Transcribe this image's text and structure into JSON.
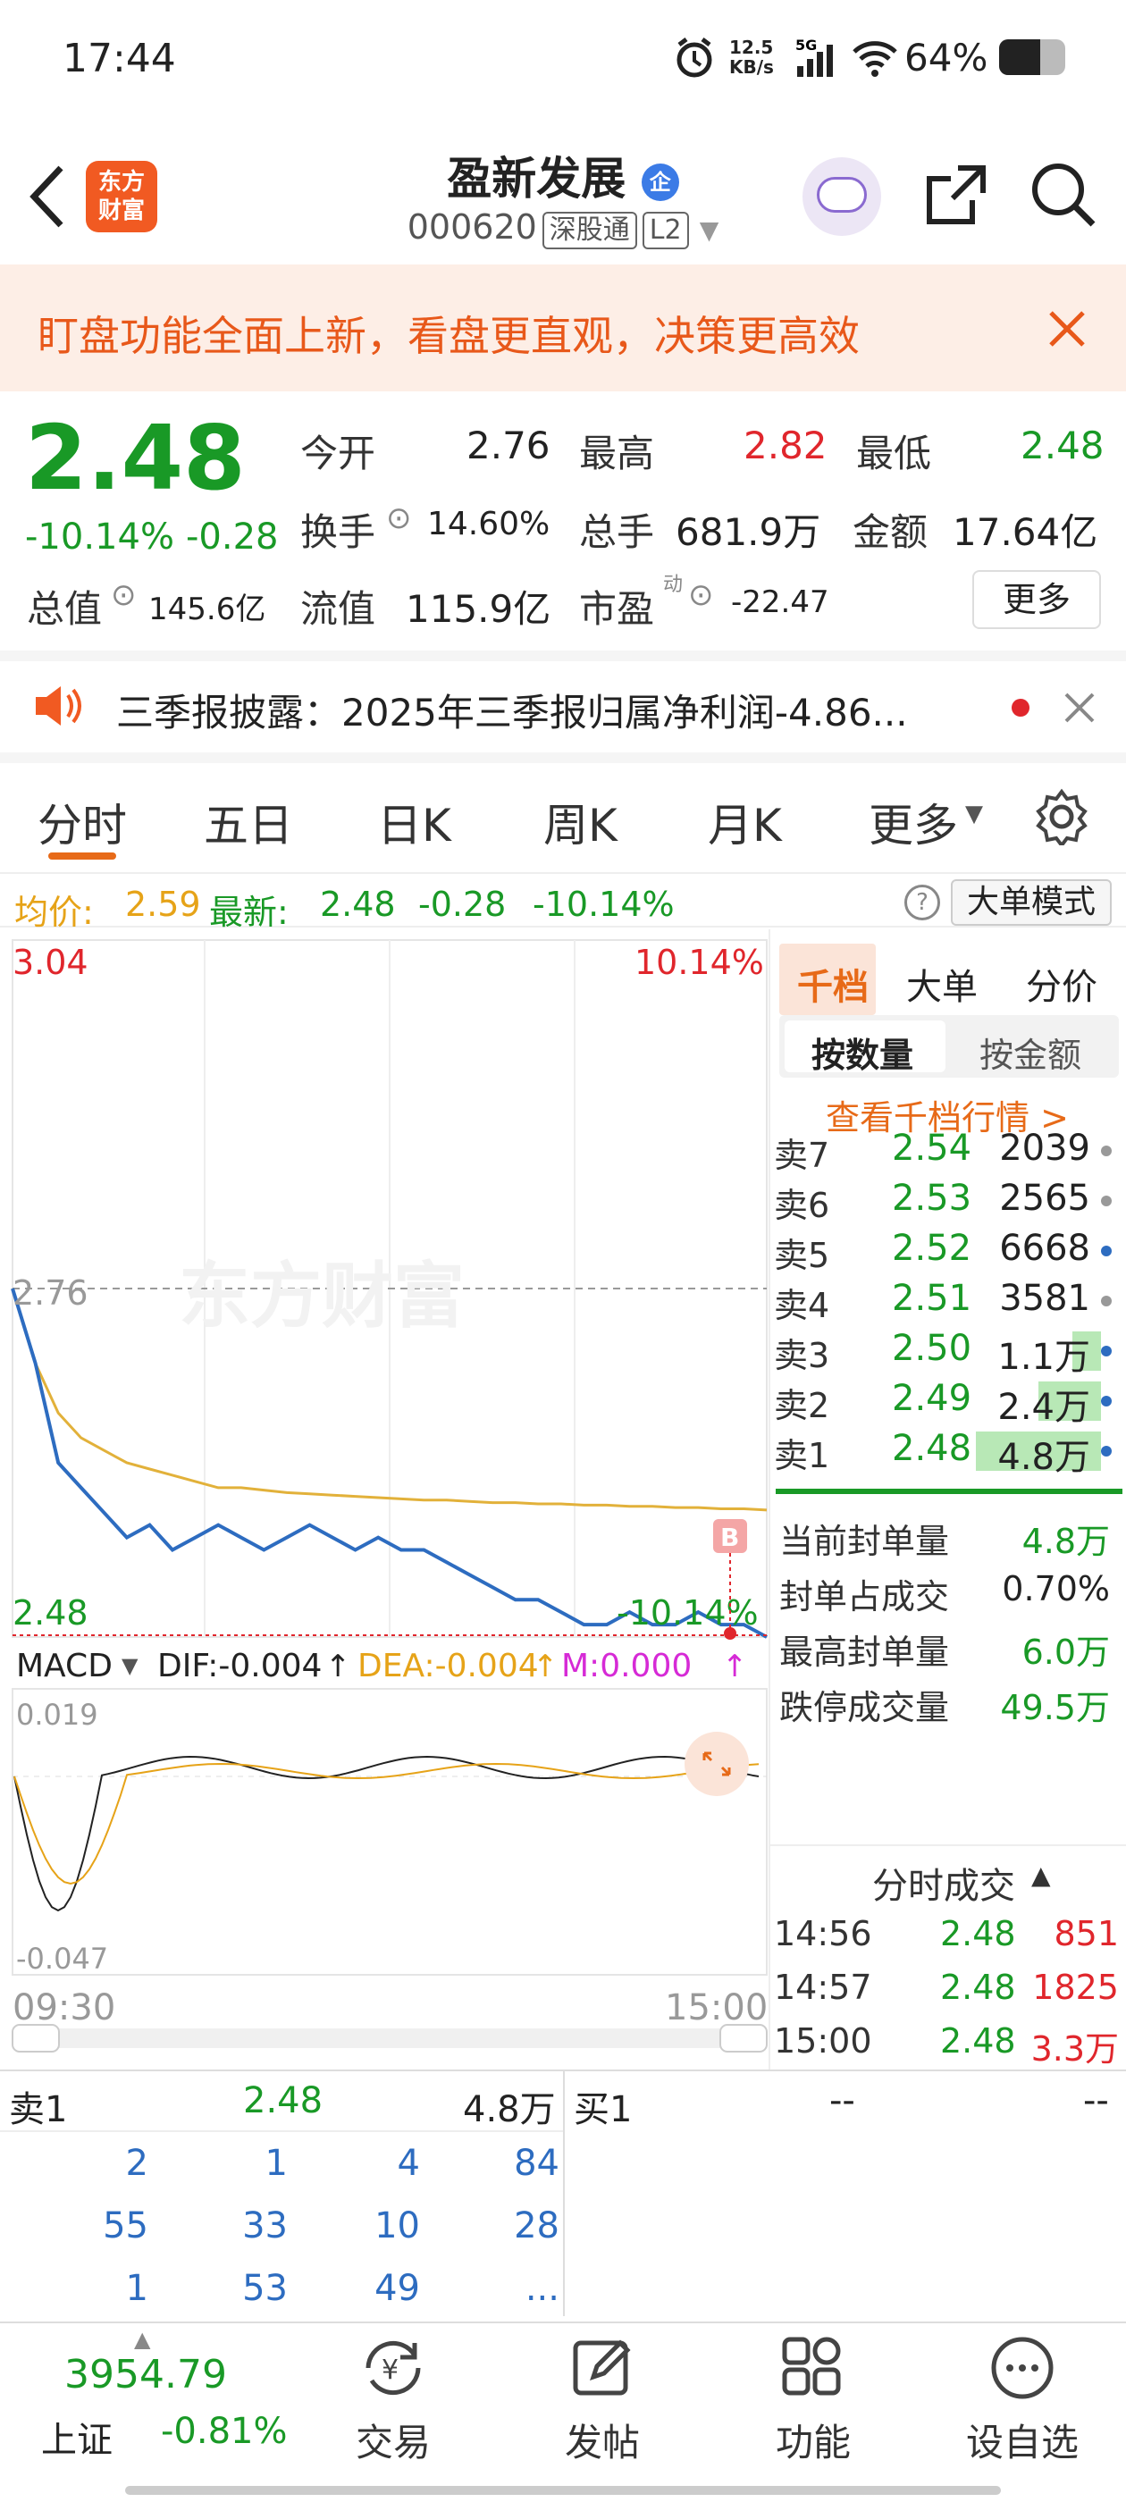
{
  "status": {
    "time": "17:44",
    "net_speed": "12.5\nKB/s",
    "battery": "64%"
  },
  "nav": {
    "logo_text": "东方\n财富",
    "title": "盈新发展",
    "title_badge": "企",
    "code": "000620",
    "tag1": "深股通",
    "tag2": "L2"
  },
  "banner": {
    "text": "盯盘功能全面上新，看盘更直观，决策更高效"
  },
  "quote": {
    "price": "2.48",
    "pct": "-10.14%",
    "chg": "-0.28",
    "open_label": "今开",
    "open": "2.76",
    "high_label": "最高",
    "high": "2.82",
    "low_label": "最低",
    "low": "2.48",
    "turnover_label": "换手",
    "turnover": "14.60%",
    "volume_label": "总手",
    "volume": "681.9万",
    "amount_label": "金额",
    "amount": "17.64亿",
    "mcap_label": "总值",
    "mcap": "145.6亿",
    "float_label": "流值",
    "float": "115.9亿",
    "pe_label": "市盈",
    "pe_sup": "动",
    "pe": "-22.47",
    "more": "更多"
  },
  "news": {
    "text": "三季报披露：2025年三季报归属净利润-4.86..."
  },
  "tabs": [
    "分时",
    "五日",
    "日K",
    "周K",
    "月K",
    "更多"
  ],
  "chart_info": {
    "avg_label": "均价:",
    "avg": "2.59",
    "latest_label": "最新:",
    "latest": "2.48",
    "latest_chg": "-0.28",
    "latest_pct": "-10.14%",
    "mode": "大单模式"
  },
  "chart_data": {
    "type": "line",
    "ylim": [
      2.48,
      3.04
    ],
    "y_labels": {
      "top": "3.04",
      "mid": "2.76",
      "bottom": "2.48",
      "top_pct": "10.14%",
      "bottom_pct": "-10.14%"
    },
    "x_labels": [
      "09:30",
      "15:00"
    ],
    "series": [
      {
        "name": "price",
        "values": [
          2.76,
          2.7,
          2.62,
          2.6,
          2.58,
          2.56,
          2.57,
          2.55,
          2.56,
          2.57,
          2.56,
          2.55,
          2.56,
          2.57,
          2.56,
          2.55,
          2.56,
          2.55,
          2.55,
          2.54,
          2.53,
          2.52,
          2.51,
          2.51,
          2.5,
          2.49,
          2.49,
          2.5,
          2.49,
          2.49,
          2.5,
          2.49,
          2.49,
          2.48
        ]
      },
      {
        "name": "avg",
        "values": [
          2.76,
          2.7,
          2.66,
          2.64,
          2.63,
          2.62,
          2.615,
          2.61,
          2.605,
          2.6,
          2.6,
          2.598,
          2.596,
          2.595,
          2.594,
          2.593,
          2.592,
          2.591,
          2.59,
          2.59,
          2.589,
          2.588,
          2.588,
          2.587,
          2.587,
          2.586,
          2.586,
          2.585,
          2.585,
          2.584,
          2.584,
          2.583,
          2.583,
          2.582
        ]
      }
    ],
    "macd": {
      "label": "MACD",
      "dif": "DIF:-0.004",
      "dea": "DEA:-0.004",
      "m": "M:0.000",
      "top": "0.019",
      "bottom": "-0.047"
    },
    "watermark": "东方财富"
  },
  "panel": {
    "tabs": [
      "千档",
      "大单",
      "分价"
    ],
    "subtabs": [
      "按数量",
      "按金额"
    ],
    "link": "查看千档行情 >",
    "asks": [
      {
        "label": "卖7",
        "price": "2.54",
        "vol": "2039"
      },
      {
        "label": "卖6",
        "price": "2.53",
        "vol": "2565"
      },
      {
        "label": "卖5",
        "price": "2.52",
        "vol": "6668"
      },
      {
        "label": "卖4",
        "price": "2.51",
        "vol": "3581"
      },
      {
        "label": "卖3",
        "price": "2.50",
        "vol": "1.1万"
      },
      {
        "label": "卖2",
        "price": "2.49",
        "vol": "2.4万"
      },
      {
        "label": "卖1",
        "price": "2.48",
        "vol": "4.8万"
      }
    ],
    "stats": [
      {
        "label": "当前封单量",
        "value": "4.8万"
      },
      {
        "label": "封单占成交",
        "value": "0.70%"
      },
      {
        "label": "最高封单量",
        "value": "6.0万"
      },
      {
        "label": "跌停成交量",
        "value": "49.5万"
      }
    ],
    "ticks_title": "分时成交",
    "ticks": [
      {
        "time": "14:56",
        "price": "2.48",
        "vol": "851"
      },
      {
        "time": "14:57",
        "price": "2.48",
        "vol": "1825"
      },
      {
        "time": "15:00",
        "price": "2.48",
        "vol": "3.3万"
      }
    ]
  },
  "queue": {
    "sell_label": "卖1",
    "sell_price": "2.48",
    "sell_vol": "4.8万",
    "buy_label": "买1",
    "buy_price": "--",
    "buy_vol": "--",
    "rows": [
      [
        "2",
        "1",
        "4",
        "84"
      ],
      [
        "55",
        "33",
        "10",
        "28"
      ],
      [
        "1",
        "53",
        "49",
        "..."
      ]
    ]
  },
  "bottom": {
    "index_value": "3954.79",
    "index_name": "上证",
    "index_pct": "-0.81%",
    "items": [
      "交易",
      "发帖",
      "功能",
      "设自选"
    ]
  }
}
